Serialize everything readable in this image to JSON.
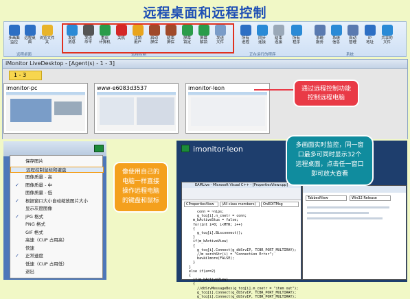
{
  "page": {
    "title": "远程桌面和远程控制"
  },
  "ribbon": {
    "buttons": [
      {
        "label": "多画面\n监控",
        "icon": "monitor-icon",
        "color": "#2d6fc4"
      },
      {
        "label": "远程桌\n面",
        "icon": "remote-desktop-icon",
        "color": "#2d6fc4"
      },
      {
        "label": "浏览文件\n夹",
        "icon": "folder-icon",
        "color": "#e8b42a"
      },
      {
        "label": "发送\n消息",
        "icon": "message-icon",
        "color": "#2a8ad6"
      },
      {
        "label": "发送\n命令",
        "icon": "command-icon",
        "color": "#555555"
      },
      {
        "label": "重启\n计算机",
        "icon": "restart-icon",
        "color": "#2a9c4a"
      },
      {
        "label": "关机",
        "icon": "power-icon",
        "color": "#d42727"
      },
      {
        "label": "注销\n用户",
        "icon": "logoff-icon",
        "color": "#e9a41c"
      },
      {
        "label": "启动\n屏保",
        "icon": "screensaver-start-icon",
        "color": "#a04a2a"
      },
      {
        "label": "结束\n屏保",
        "icon": "screensaver-stop-icon",
        "color": "#a04a2a"
      },
      {
        "label": "屏幕\n锁定",
        "icon": "lock-icon",
        "color": "#2a9c4a"
      },
      {
        "label": "屏幕\n解锁",
        "icon": "unlock-icon",
        "color": "#2a9c4a"
      },
      {
        "label": "发送\n文件",
        "icon": "send-file-icon",
        "color": "#7a9cc8"
      },
      {
        "label": "所有\n进程",
        "icon": "process-icon",
        "color": "#2d6fc4"
      },
      {
        "label": "同步\n连接",
        "icon": "sync-icon",
        "color": "#2a8ad6"
      },
      {
        "label": "结束\n连接",
        "icon": "disconnect-icon",
        "color": "#9aa8b8"
      },
      {
        "label": "所有\n程序",
        "icon": "programs-icon",
        "color": "#2a8ad6"
      },
      {
        "label": "系统\n服务",
        "icon": "service-icon",
        "color": "#5a7ab0"
      },
      {
        "label": "系统\n信息",
        "icon": "info-icon",
        "color": "#2a8ad6"
      },
      {
        "label": "自动\n管理",
        "icon": "auto-icon",
        "color": "#5a7ab0"
      },
      {
        "label": "IP\n地址",
        "icon": "ip-icon",
        "color": "#2d6fc4"
      },
      {
        "label": "共享的\n文件",
        "icon": "share-icon",
        "color": "#2a8ad6"
      }
    ],
    "groups": [
      "远程桌面",
      "远程控制",
      "正在运行的程序",
      "系统"
    ]
  },
  "window": {
    "title": "iMonitor LiveDesktop - [Agent(s) - 1 - 3]",
    "tab": "1 - 3"
  },
  "thumbs": [
    {
      "name": "imonitor-pc"
    },
    {
      "name": "www-e6083d3537"
    },
    {
      "name": "imonitor-leon"
    }
  ],
  "callouts": {
    "c1": "通过远程控制功能\n控制远程电脑",
    "c2": "多画面实时监控，同一窗\n口最多可同时显示32个\n远程桌面，点击任一窗口\n即可放大查看",
    "c3": "像使用自己的\n电脑一样直接\n操作远程电脑\n的键盘和鼠标"
  },
  "menu": {
    "items": [
      {
        "label": "保存图片",
        "checked": false
      },
      {
        "label": "远程控制鼠标和键盘",
        "checked": false,
        "highlight": true
      },
      {
        "label": "图像质量 - 高",
        "checked": false
      },
      {
        "label": "图像质量 - 中",
        "checked": true
      },
      {
        "label": "图像质量 - 低",
        "checked": false
      },
      {
        "label": "根据窗口大小自动缩放图片大小",
        "checked": true
      },
      {
        "label": "显示灰度图像",
        "checked": false
      },
      {
        "label": "JPG 格式",
        "checked": true
      },
      {
        "label": "PNG 格式",
        "checked": false
      },
      {
        "label": "GIF 格式",
        "checked": false
      },
      {
        "label": "高速（CUP 占用高）",
        "checked": false
      },
      {
        "label": "快速",
        "checked": false
      },
      {
        "label": "正常速度",
        "checked": true
      },
      {
        "label": "低速（CUP 占用低）",
        "checked": false
      },
      {
        "label": "退出",
        "checked": false
      }
    ]
  },
  "remote": {
    "name": "imonitor-leon",
    "vs_title": "EAMLive - Microsoft Visual C++ - [PropertiesView.cpp]",
    "sel1": "CPropertiesView",
    "sel2": "(All class members)",
    "sel3": "OnEDITMsg",
    "sel4": "TabbedView",
    "sel5": "Win32 Release",
    "code": "      conn = ~nips;\n      g_tcq[i].n_cnetr = conn;\n    m_bActiveStus = false;\n    for(int i=0; i<MTR; i++)\n    {\n      g_tcq[i].Bisconnect();\n    }\n    if(m_bActiveView)\n    {\n      g_tcq[i].Connect(g_dbSrvIP, TCBR_PORT_MULTIRAY);\n      //m_serchStr(i) = \"Connection Error\";\n      bavailmore(FALSE);\n    }\n  }\n  else if(a==2)\n  {\n    if(m_bActiveView)\n    {\n      //dbSrvMessageBox(g_tcq[i].m_cnetr = \"item out\");\n      g_tcq[i].Connect(g_dbSrvIP, TCBR_PORT_MULTIRAY);\n      g_tcq[i].Connect(g_dbSrvIP, TCBR_PORT_MULTIRAY);"
  }
}
